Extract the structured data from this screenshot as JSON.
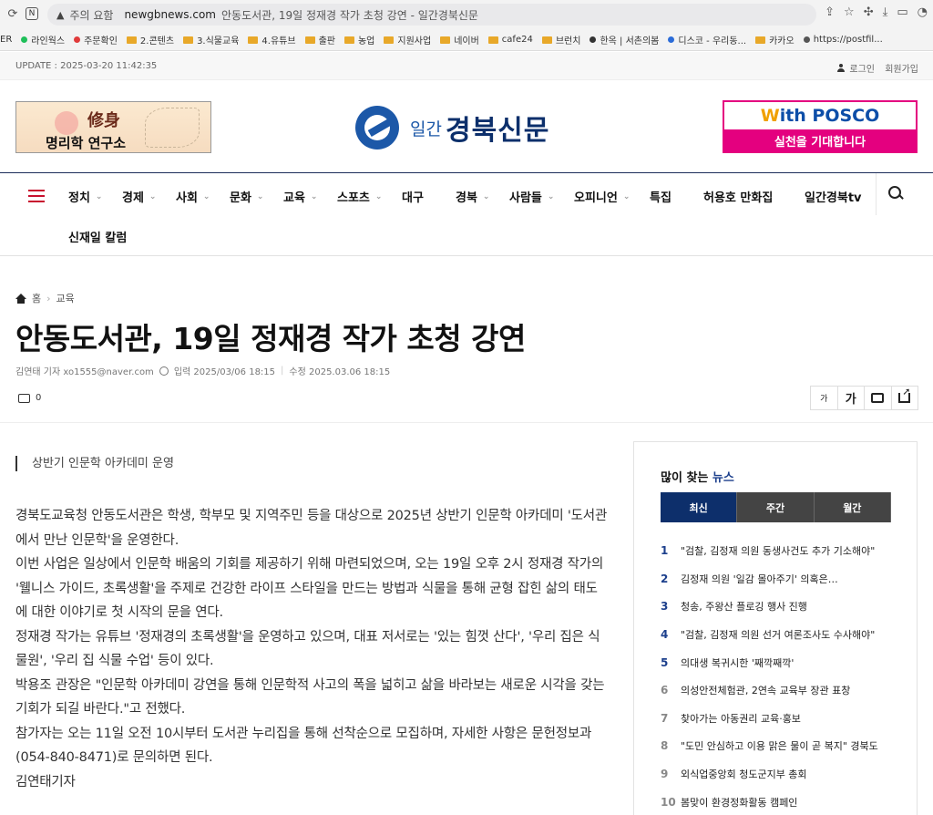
{
  "browser": {
    "security_label": "주의 요함",
    "host": "newgbnews.com",
    "page_title": "안동도서관, 19일 정재경 작가 초청 강연 - 일간경북신문"
  },
  "bookmarks": [
    {
      "label": "ER",
      "kind": "text"
    },
    {
      "label": "라인웍스",
      "kind": "dot",
      "color": "#1fbf5a"
    },
    {
      "label": "주문확인",
      "kind": "dot",
      "color": "#e03a3a"
    },
    {
      "label": "2.콘텐츠",
      "kind": "folder"
    },
    {
      "label": "3.식물교육",
      "kind": "folder"
    },
    {
      "label": "4.유튜브",
      "kind": "folder"
    },
    {
      "label": "출판",
      "kind": "folder"
    },
    {
      "label": "농업",
      "kind": "folder"
    },
    {
      "label": "지원사업",
      "kind": "folder"
    },
    {
      "label": "네이버",
      "kind": "folder"
    },
    {
      "label": "cafe24",
      "kind": "folder"
    },
    {
      "label": "브런치",
      "kind": "folder"
    },
    {
      "label": "한옥 | 서촌의봄",
      "kind": "dot",
      "color": "#333333"
    },
    {
      "label": "디스코 - 우리동...",
      "kind": "dot",
      "color": "#2b6cd8"
    },
    {
      "label": "카카오",
      "kind": "folder"
    },
    {
      "label": "https://postfil...",
      "kind": "dot",
      "color": "#555555"
    }
  ],
  "util": {
    "update": "UPDATE : 2025-03-20 11:42:35",
    "login": "로그인",
    "join": "회원가입"
  },
  "header": {
    "ad_left": {
      "hanja": "修身",
      "name": "명리학 연구소"
    },
    "logo": {
      "small": "일간",
      "big": "경북신문"
    },
    "ad_right": {
      "brand_w": "W",
      "brand_rest": "ith POSCO",
      "tagline": "실천을 기대합니다"
    }
  },
  "nav": {
    "items": [
      {
        "label": "정치",
        "has_menu": true
      },
      {
        "label": "경제",
        "has_menu": true
      },
      {
        "label": "사회",
        "has_menu": true
      },
      {
        "label": "문화",
        "has_menu": true
      },
      {
        "label": "교육",
        "has_menu": true
      },
      {
        "label": "스포츠",
        "has_menu": true
      },
      {
        "label": "대구",
        "has_menu": false
      },
      {
        "label": "경북",
        "has_menu": true
      },
      {
        "label": "사람들",
        "has_menu": true
      },
      {
        "label": "오피니언",
        "has_menu": true
      },
      {
        "label": "특집",
        "has_menu": false
      },
      {
        "label": "허용호 만화집",
        "has_menu": false
      },
      {
        "label": "일간경북tv",
        "has_menu": false
      }
    ],
    "second_row": "신재일 칼럼"
  },
  "article": {
    "breadcrumb": {
      "home": "홈",
      "section": "교육"
    },
    "title": "안동도서관, 19일 정재경 작가 초청 강연",
    "author": "김연태 기자 xo1555@naver.com",
    "published": "입력 2025/03/06 18:15",
    "modified": "수정 2025.03.06 18:15",
    "comment_count": "0",
    "tools": {
      "font_small": "가",
      "font_big": "가"
    },
    "subtitle": "상반기 인문학 아카데미 운영",
    "paragraphs": [
      "경북도교육청 안동도서관은 학생, 학부모 및 지역주민 등을 대상으로 2025년 상반기 인문학 아카데미 '도서관에서 만난 인문학'을 운영한다.",
      "이번 사업은 일상에서 인문학 배움의 기회를 제공하기 위해 마련되었으며, 오는 19일 오후 2시 정재경 작가의 '웰니스 가이드, 초록생활'을 주제로 건강한 라이프 스타일을 만드는 방법과 식물을 통해 균형 잡힌 삶의 태도에 대한 이야기로 첫 시작의 문을 연다.",
      "정재경 작가는 유튜브 '정재경의 초록생활'을 운영하고 있으며, 대표 저서로는 '있는 힘껏 산다', '우리 집은 식물원', '우리 집 식물 수업' 등이 있다.",
      "박용조 관장은 \"인문학 아카데미 강연을 통해 인문학적 사고의 폭을 넓히고 삶을 바라보는 새로운 시각을 갖는 기회가 되길 바란다.\"고 전했다.",
      "참가자는 오는 11일 오전 10시부터 도서관 누리집을 통해 선착순으로 모집하며, 자세한 사항은 문헌정보과(054-840-8471)로 문의하면 된다.",
      "김연태기자"
    ]
  },
  "sidebar": {
    "title_prefix": "많이 찾는",
    "title_accent": "뉴스",
    "tabs": [
      "최신",
      "주간",
      "월간"
    ],
    "active_tab": "최신",
    "items": [
      {
        "rank": "1",
        "text": "\"검찰, 김정재 의원 동생사건도 추가 기소해야\""
      },
      {
        "rank": "2",
        "text": "김정재 의원 '일감 몰아주기' 의혹은…"
      },
      {
        "rank": "3",
        "text": "청송, 주왕산 플로깅 행사 진행"
      },
      {
        "rank": "4",
        "text": "\"검찰, 김정재 의원 선거 여론조사도 수사해야\""
      },
      {
        "rank": "5",
        "text": "의대생 복귀시한 '째깍째깍'"
      },
      {
        "rank": "6",
        "text": "의성안전체험관, 2연속 교육부 장관 표창"
      },
      {
        "rank": "7",
        "text": "찾아가는 아동권리 교육·홍보"
      },
      {
        "rank": "8",
        "text": "\"도민 안심하고 이용 맑은 물이 곧 복지\" 경북도"
      },
      {
        "rank": "9",
        "text": "외식업중앙회 청도군지부 총회"
      },
      {
        "rank": "10",
        "text": "봄맞이 환경정화활동 캠페인"
      }
    ]
  },
  "colors": {
    "brand_navy": "#0d2f6b",
    "nav_accent": "#c8102e",
    "posco_pink": "#e4007f"
  }
}
